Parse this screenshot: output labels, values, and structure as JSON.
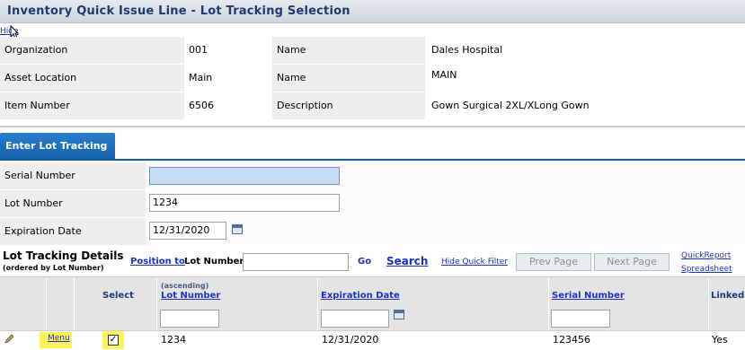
{
  "window": {
    "title": "Inventory Quick Issue Line - Lot Tracking Selection",
    "hide_link": "Hide"
  },
  "info": {
    "rows": [
      {
        "label1": "Organization",
        "value1": "001",
        "label2": "Name",
        "value2": "Dales Hospital"
      },
      {
        "label1": "Asset Location",
        "value1": "Main",
        "label2": "Name",
        "value2": "MAIN"
      },
      {
        "label1": "Item Number",
        "value1": "6506",
        "label2": "Description",
        "value2": "Gown Surgical 2XL/XLong Gown"
      }
    ]
  },
  "tab": {
    "label": "Enter Lot Tracking"
  },
  "form": {
    "serial_label": "Serial Number",
    "serial_value": "",
    "lot_label": "Lot Number",
    "lot_value": "1234",
    "exp_label": "Expiration Date",
    "exp_value": "12/31/2020"
  },
  "details": {
    "title": "Lot Tracking Details",
    "subtitle": "(ordered by Lot Number)",
    "position_to": "Position to",
    "position_field": "Lot Number",
    "position_value": "",
    "go": "Go",
    "search": "Search",
    "hide_quick_filter": "Hide Quick Filter",
    "prev_page": "Prev Page",
    "next_page": "Next Page",
    "quick_report": "QuickReport",
    "spreadsheet": "Spreadsheet"
  },
  "grid": {
    "headers": {
      "select": "Select",
      "sort_note": "(ascending)",
      "lot": "Lot Number",
      "exp": "Expiration Date",
      "serial": "Serial Number",
      "linked": "Linked"
    },
    "rows": [
      {
        "menu": "Menu",
        "selected": true,
        "lot": "1234",
        "exp": "12/31/2020",
        "serial": "123456",
        "linked": "Yes"
      }
    ]
  }
}
